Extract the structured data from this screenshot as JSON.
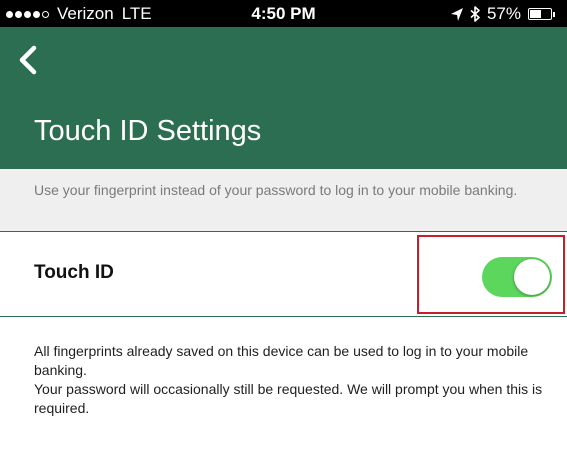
{
  "status_bar": {
    "carrier": "Verizon",
    "network": "LTE",
    "time": "4:50 PM",
    "battery_percent": "57%",
    "battery_level": 0.57,
    "location_icon": "location-arrow-icon",
    "bluetooth_icon": "bluetooth-icon"
  },
  "header": {
    "title": "Touch ID Settings",
    "back_icon": "chevron-left-icon",
    "background_color": "#2b6e52"
  },
  "description": "Use your fingerprint instead of your password to log in to your mobile banking.",
  "touch_id": {
    "label": "Touch ID",
    "enabled": true,
    "toggle_color": "#5cd65c",
    "highlight_color": "#c5202a"
  },
  "info": {
    "line1": "All fingerprints already saved on this device can be used to log in to your mobile banking.",
    "line2": "Your password will occasionally still be requested. We will prompt you when this is required."
  }
}
